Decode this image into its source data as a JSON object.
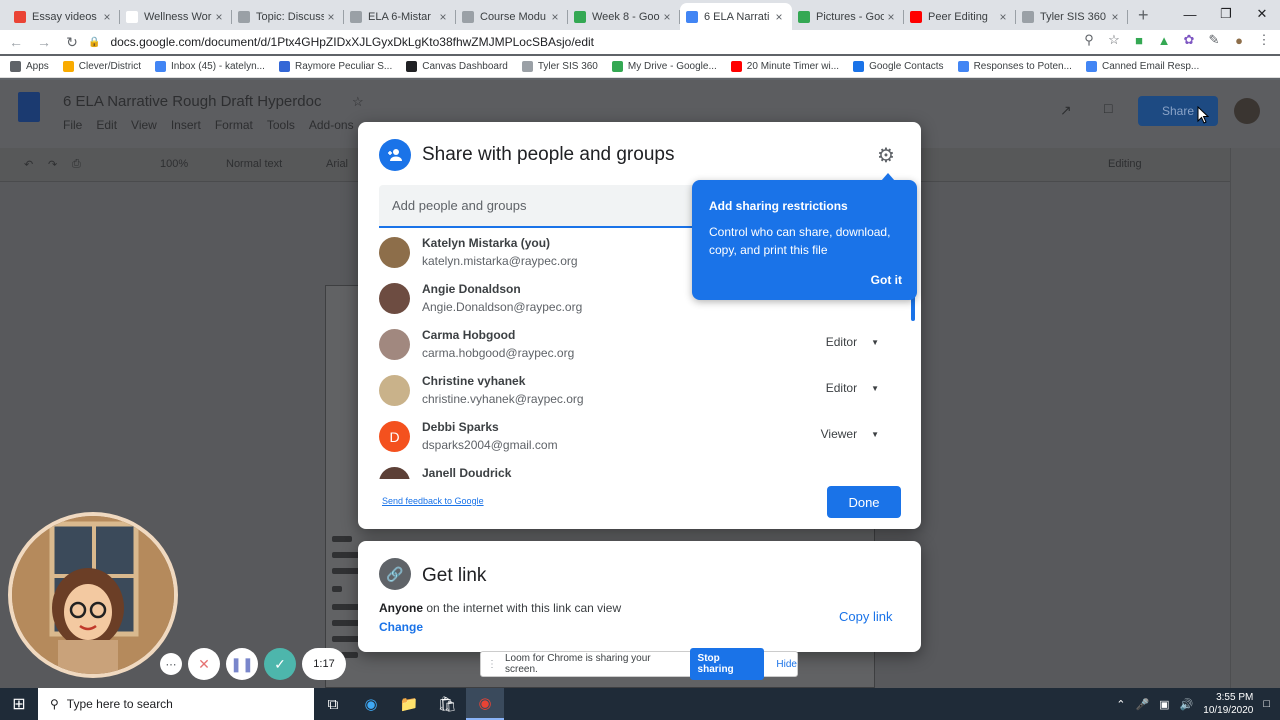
{
  "browser": {
    "tabs": [
      {
        "label": "Essay videos",
        "color": "#ea4335",
        "icon": "gmail-icon"
      },
      {
        "label": "Wellness Wor",
        "color": "#ffffff",
        "icon": "page-icon"
      },
      {
        "label": "Topic: Discuss",
        "color": "#9aa0a6",
        "icon": "page-icon"
      },
      {
        "label": "ELA 6-Mistar",
        "color": "#9aa0a6",
        "icon": "page-icon"
      },
      {
        "label": "Course Modu",
        "color": "#9aa0a6",
        "icon": "page-icon"
      },
      {
        "label": "Week 8 - Goo",
        "color": "#34a853",
        "icon": "drive-icon"
      },
      {
        "label": "6 ELA Narrati",
        "color": "#4285f4",
        "icon": "docs-icon",
        "active": true
      },
      {
        "label": "Pictures - Goo",
        "color": "#34a853",
        "icon": "drive-icon"
      },
      {
        "label": "Peer Editing",
        "color": "#ff0000",
        "icon": "youtube-icon"
      },
      {
        "label": "Tyler SIS 360",
        "color": "#9aa0a6",
        "icon": "page-icon"
      }
    ],
    "url": "docs.google.com/document/d/1Ptx4GHpZIDxXJLGyxDkLgKto38fhwZMJMPLocSBAsjo/edit",
    "bookmarks": [
      {
        "label": "Apps",
        "color": "#5f6368"
      },
      {
        "label": "Clever/District",
        "color": "#f9ab00"
      },
      {
        "label": "Inbox (45) - katelyn...",
        "color": "#4285f4"
      },
      {
        "label": "Raymore Peculiar S...",
        "color": "#3367d6"
      },
      {
        "label": "Canvas Dashboard",
        "color": "#202124"
      },
      {
        "label": "Tyler SIS 360",
        "color": "#9aa0a6"
      },
      {
        "label": "My Drive - Google...",
        "color": "#34a853"
      },
      {
        "label": "20 Minute Timer wi...",
        "color": "#ff0000"
      },
      {
        "label": "Google Contacts",
        "color": "#1a73e8"
      },
      {
        "label": "Responses to Poten...",
        "color": "#4285f4"
      },
      {
        "label": "Canned Email Resp...",
        "color": "#4285f4"
      }
    ]
  },
  "doc": {
    "title": "6 ELA Narrative Rough Draft Hyperdoc",
    "menu": [
      "File",
      "Edit",
      "View",
      "Insert",
      "Format",
      "Tools",
      "Add-ons"
    ],
    "share_label": "Share",
    "zoom": "100%",
    "style": "Normal text",
    "font": "Arial",
    "mode": "Editing"
  },
  "dialog": {
    "title": "Share with people and groups",
    "input_placeholder": "Add people and groups",
    "people": [
      {
        "name": "Katelyn Mistarka (you)",
        "email": "katelyn.mistarka@raypec.org",
        "role": "",
        "color": "#8d6e4a"
      },
      {
        "name": "Angie Donaldson",
        "email": "Angie.Donaldson@raypec.org",
        "role": "Editor",
        "color": "#6d4c41"
      },
      {
        "name": "Carma Hobgood",
        "email": "carma.hobgood@raypec.org",
        "role": "Editor",
        "color": "#a1887f"
      },
      {
        "name": "Christine vyhanek",
        "email": "christine.vyhanek@raypec.org",
        "role": "Editor",
        "color": "#c9b28a"
      },
      {
        "name": "Debbi Sparks",
        "email": "dsparks2004@gmail.com",
        "role": "Viewer",
        "color": "#f4511e",
        "initial": "D"
      },
      {
        "name": "Janell Doudrick",
        "email": "",
        "role": "",
        "color": "#5d4037"
      }
    ],
    "feedback": "Send feedback to Google",
    "done": "Done"
  },
  "callout": {
    "title": "Add sharing restrictions",
    "body": "Control who can share, download, copy, and print this file",
    "button": "Got it"
  },
  "link": {
    "title": "Get link",
    "anyone": "Anyone",
    "desc": "on the internet with this link can view",
    "change": "Change",
    "copy": "Copy link"
  },
  "loom": {
    "message": "Loom for Chrome is sharing your screen.",
    "stop": "Stop sharing",
    "hide": "Hide",
    "timer": "1:17"
  },
  "taskbar": {
    "search_placeholder": "Type here to search",
    "time": "3:55 PM",
    "date": "10/19/2020"
  }
}
